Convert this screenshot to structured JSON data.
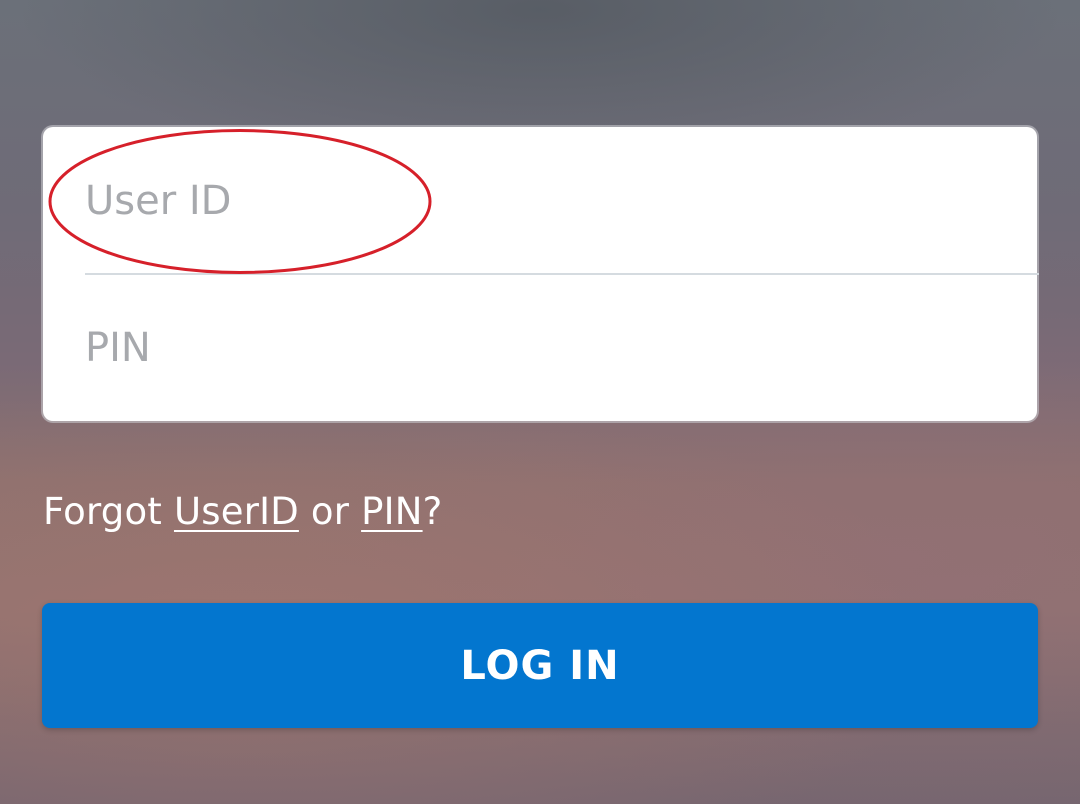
{
  "form": {
    "userid_placeholder": "User ID",
    "pin_placeholder": "PIN"
  },
  "forgot": {
    "prefix": "Forgot ",
    "userid_link": "UserID",
    "middle": " or ",
    "pin_link": "PIN",
    "suffix": "?"
  },
  "login_button": {
    "label": "LOG IN"
  },
  "colors": {
    "primary": "#0376cf",
    "highlight": "#d6202a",
    "placeholder": "#a7a9ad"
  }
}
